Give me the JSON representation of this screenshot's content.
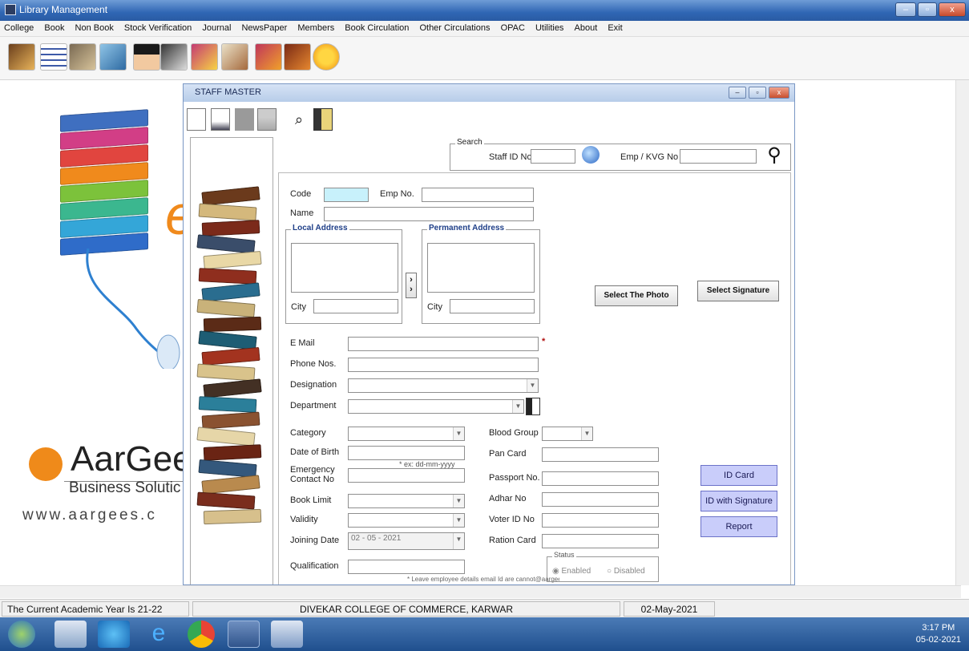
{
  "window": {
    "title": "Library Management"
  },
  "menu": [
    "College",
    "Book",
    "Non Book",
    "Stock Verification",
    "Journal",
    "NewsPaper",
    "Members",
    "Book Circulation",
    "Other Circulations",
    "OPAC",
    "Utilities",
    "About",
    "Exit"
  ],
  "splash": {
    "brand": "AarGee",
    "sub": "Business Solutic",
    "url": "www.aargees.c",
    "letter": "e"
  },
  "child": {
    "title": "STAFF MASTER",
    "search": {
      "legend": "Search",
      "staff_id_label": "Staff ID No",
      "emp_label": "Emp / KVG  No"
    },
    "form": {
      "code": "Code",
      "emp_no": "Emp No.",
      "name": "Name",
      "local_address": "Local Address",
      "permanent_address": "Permanent Address",
      "city": "City",
      "copy_btn": "›\n›",
      "select_photo": "Select The Photo",
      "select_signature": "Select Signature",
      "email": "E Mail",
      "required": "*",
      "phone": "Phone Nos.",
      "designation": "Designation",
      "department": "Department",
      "category": "Category",
      "dob": "Date of Birth",
      "dob_hint": "* ex: dd-mm-yyyy",
      "emergency": "Emergency\nContact No",
      "book_limit": "Book Limit",
      "validity": "Validity",
      "joining_date": "Joining Date",
      "joining_value": "02 - 05 - 2021",
      "qualification": "Qualification",
      "blood_group": "Blood Group",
      "pan_card": "Pan Card",
      "passport": "Passport No.",
      "adhar": "Adhar No",
      "voter": "Voter ID No",
      "ration": "Ration Card",
      "status_legend": "Status",
      "enabled": "Enabled",
      "disabled": "Disabled",
      "id_card": "ID Card",
      "id_with_sig": "ID with Signature",
      "report": "Report",
      "footer_hint": "* Leave employee details email Id are cannot@aargee.com"
    }
  },
  "status": {
    "year": "The Current Academic Year Is 21-22",
    "college": "DIVEKAR COLLEGE OF COMMERCE, KARWAR",
    "date": "02-May-2021"
  },
  "clock": {
    "time": "3:17 PM",
    "date": "05-02-2021"
  },
  "colors": {
    "title_bar": "#2f66b4",
    "code_field": "#c8f1fb",
    "blue_button": "#c9cdfa",
    "logo": "#ef8a1a"
  }
}
